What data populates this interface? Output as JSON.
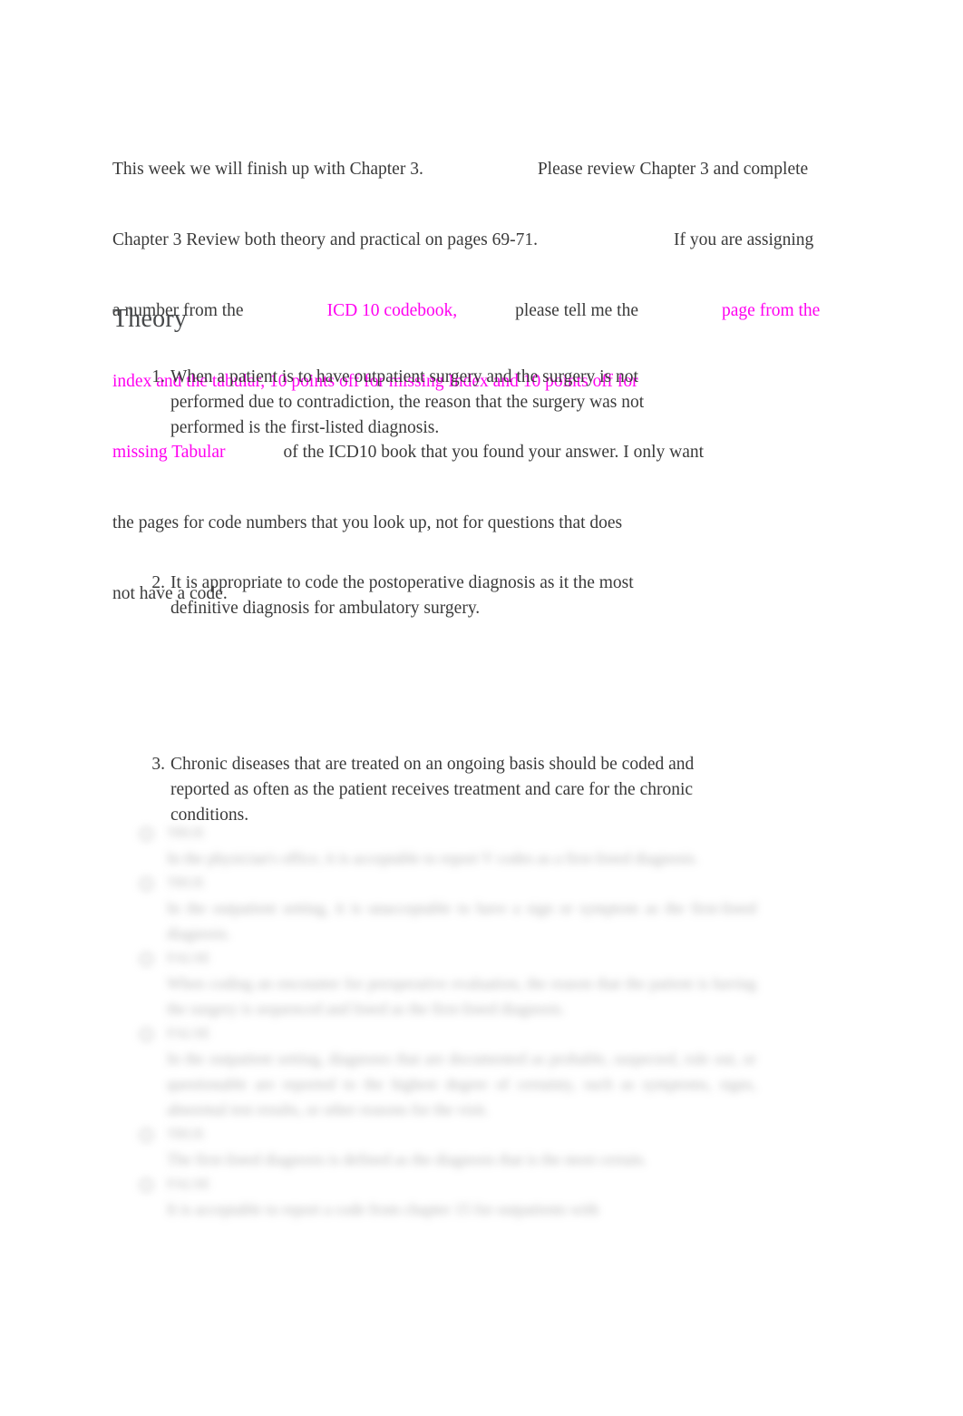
{
  "document": {
    "background_color": "#ffffff",
    "text_color": "#3a3a3a",
    "highlight_color": "#ff00f0"
  },
  "intro": {
    "line1_a": "This week we will finish up with Chapter 3.",
    "line1_b": "Please review Chapter 3 and complete",
    "line2_a": "Chapter 3 Review both theory and practical on pages 69-71.",
    "line2_b": "If you are assigning",
    "line3_a": "a number from the",
    "line3_hl": "ICD 10 codebook,",
    "line3_b": "please tell me the",
    "line3_hl2": "page from the",
    "line4_hl": "index and the tabular, 10 points off for missing Index and 10 points off for",
    "line5_hl": "missing Tabular",
    "line5_b": "of the ICD10 book that you found your answer. I only want",
    "line6": "the pages for code numbers that you look up, not for questions that does",
    "line7": "not have a code."
  },
  "theory": {
    "heading": "Theory"
  },
  "questions": [
    {
      "number": "1.",
      "text": "When a patient is to have outpatient surgery and the surgery is not performed due to contradiction, the reason that the surgery was not performed is the first-listed diagnosis."
    },
    {
      "number": "2.",
      "text": "It is appropriate to code the postoperative diagnosis as it the most definitive diagnosis for ambulatory surgery."
    },
    {
      "number": "3.",
      "text": "Chronic diseases that are treated on an ongoing basis should be coded and reported as often as the patient receives treatment and care for the chronic conditions."
    }
  ],
  "obscured_options": {
    "note": "blurred-illegible-content",
    "rows": [
      {
        "label": "TRUE",
        "body": ""
      },
      {
        "label": "",
        "body": "In the physician's office, it is acceptable to report V codes as a first-listed diagnosis."
      },
      {
        "label": "TRUE",
        "body": ""
      },
      {
        "label": "",
        "body": "In the outpatient setting, it is unacceptable to have a sign or symptom as the first-listed diagnosis."
      },
      {
        "label": "FALSE",
        "body": ""
      },
      {
        "label": "",
        "body": "When coding an encounter for preoperative evaluation, the reason that the patient is having the surgery is sequenced and listed as the first-listed diagnosis."
      },
      {
        "label": "FALSE",
        "body": ""
      },
      {
        "label": "",
        "body": "In the outpatient setting, diagnoses that are documented as probable, suspected, rule out, or questionable are reported to the highest degree of certainty, such as symptoms, signs, abnormal test results, or other reasons for the visit."
      },
      {
        "label": "TRUE",
        "body": ""
      },
      {
        "label": "",
        "body": "The first-listed diagnosis is defined as the diagnosis that is the most certain."
      },
      {
        "label": "FALSE",
        "body": ""
      },
      {
        "label": "",
        "body": "It is acceptable to report a code from chapter 15 for outpatients with"
      }
    ]
  }
}
